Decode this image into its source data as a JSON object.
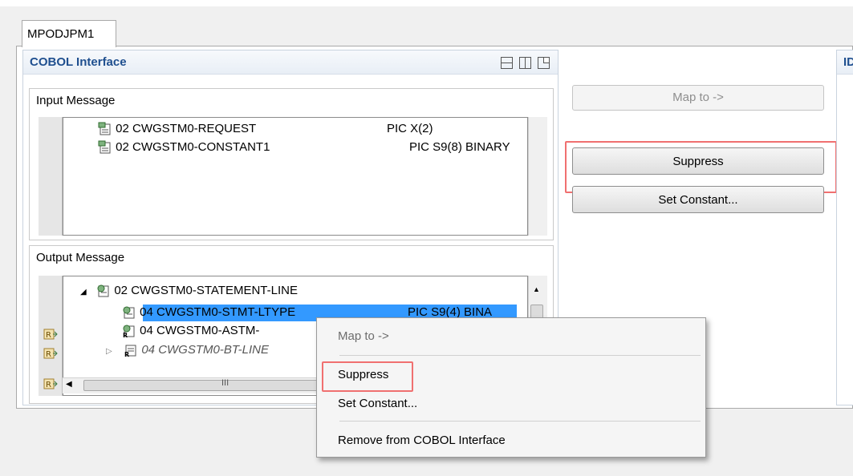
{
  "editor": {
    "tab_label": "MPODJPM1"
  },
  "cobol_panel": {
    "title": "COBOL Interface",
    "input_group_title": "Input Message",
    "output_group_title": "Output Message",
    "input_rows": [
      {
        "name": "02 CWGSTM0-REQUEST",
        "pic": "PIC X(2)"
      },
      {
        "name": "02 CWGSTM0-CONSTANT1",
        "pic": "PIC S9(8) BINARY"
      }
    ],
    "output_rows": [
      {
        "name": "02 CWGSTM0-STATEMENT-LINE",
        "pic": ""
      },
      {
        "name": "04 CWGSTM0-STMT-LTYPE",
        "pic": "PIC S9(4) BINA"
      },
      {
        "name": "04 CWGSTM0-ASTM-",
        "pic": ""
      },
      {
        "name": "04 CWGSTM0-BT-LINE",
        "pic": ""
      }
    ],
    "scroll_hint": "III"
  },
  "actions": {
    "map_to": "Map to ->",
    "suppress": "Suppress",
    "set_constant": "Set Constant..."
  },
  "right_panel": {
    "title_partial": "ID"
  },
  "context_menu": {
    "map_to": "Map to ->",
    "suppress": "Suppress",
    "set_constant": "Set Constant...",
    "remove": "Remove from COBOL Interface"
  },
  "colors": {
    "accent_title": "#1f4f8f",
    "selection": "#3399ff",
    "highlight_box": "#f07070"
  }
}
